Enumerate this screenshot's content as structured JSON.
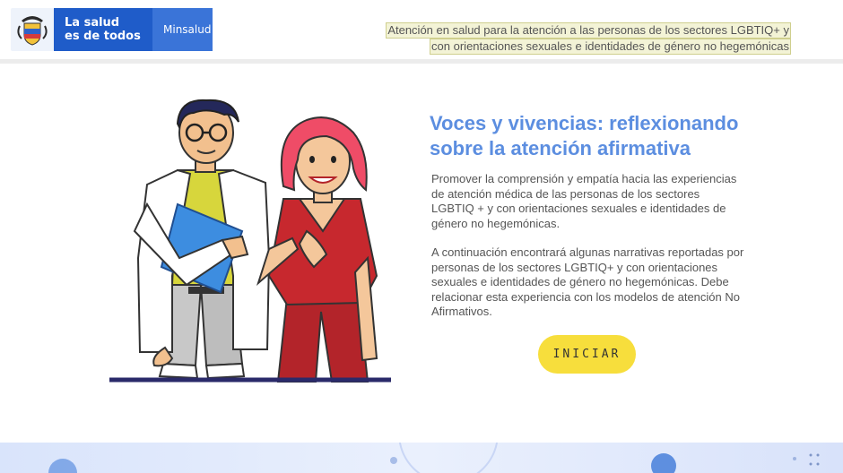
{
  "header": {
    "logo": {
      "line1": "La salud",
      "line2": "es de todos",
      "ministry": "Minsalud"
    },
    "title_line1": "Atención en salud para la atención a las personas de los sectores LGBTIQ+ y",
    "title_line2": "con orientaciones sexuales e identidades de género no hegemónicas"
  },
  "main": {
    "title": "Voces y vivencias: reflexionando sobre la atención afirmativa",
    "paragraph1": "Promover la comprensión y empatía hacia las experiencias de atención médica de las personas de los sectores LGBTIQ + y con orientaciones sexuales e identidades de género no hegemónicas.",
    "paragraph2": "A continuación encontrará algunas narrativas reportadas por personas de los sectores LGBTIQ+ y con orientaciones sexuales e identidades de género no hegemónicas. Debe relacionar esta experiencia con los modelos de atención No Afirmativos.",
    "start_button": "INICIAR"
  },
  "colors": {
    "brand_blue": "#1f5cc9",
    "title_blue": "#5c8ee0",
    "button_yellow": "#f7de3c"
  }
}
